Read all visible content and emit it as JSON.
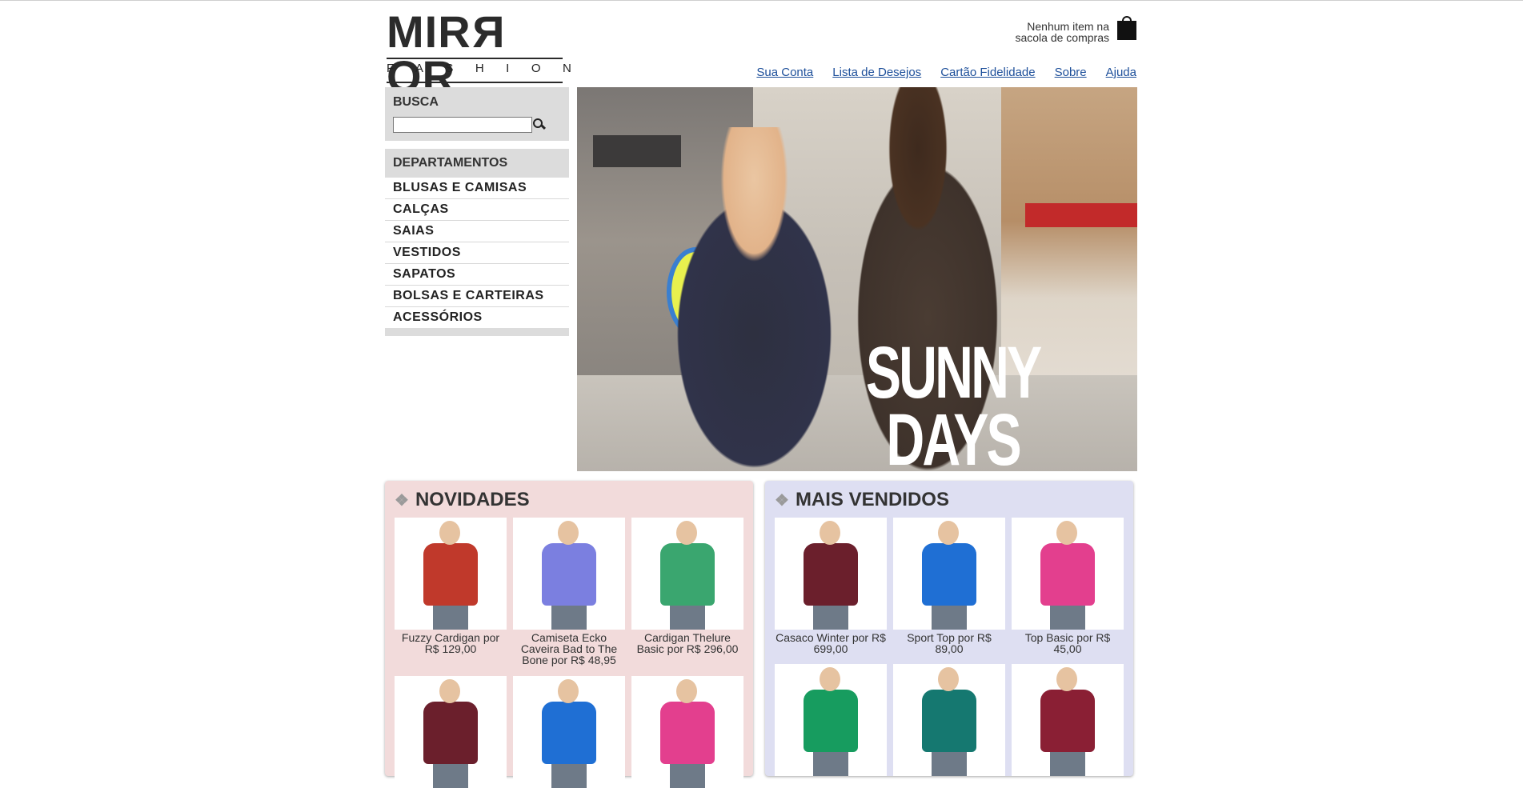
{
  "brand": {
    "logo_main": "MIRROR",
    "logo_sub": "FASHION"
  },
  "bag": {
    "text_line1": "Nenhum item na",
    "text_line2": "sacola de compras",
    "icon": "shopping-bag-icon"
  },
  "nav": {
    "links": [
      "Sua Conta",
      "Lista de Desejos",
      "Cartão Fidelidade",
      "Sobre",
      "Ajuda"
    ],
    "link_color": "#1d4f9a"
  },
  "search": {
    "title": "BUSCA",
    "value": "",
    "placeholder": "",
    "button_icon": "search-icon"
  },
  "departments": {
    "title": "DEPARTAMENTOS",
    "items": [
      "BLUSAS E CAMISAS",
      "CALÇAS",
      "SAIAS",
      "VESTIDOS",
      "SAPATOS",
      "BOLSAS E CARTEIRAS",
      "ACESSÓRIOS"
    ]
  },
  "banner": {
    "text_line1": "SUNNY",
    "text_line2": "DAYS"
  },
  "novidades": {
    "title": "NOVIDADES",
    "bg_color": "#f2dbdb",
    "products": [
      {
        "caption": "Fuzzy Cardigan por R$ 129,00",
        "color": "#c0392b"
      },
      {
        "caption": "Camiseta Ecko Caveira Bad to The Bone por R$ 48,95",
        "color": "#7b7fe0"
      },
      {
        "caption": "Cardigan Thelure Basic por R$ 296,00",
        "color": "#3aa66f"
      },
      {
        "caption": "",
        "color": "#6b1f2c"
      },
      {
        "caption": "",
        "color": "#1f6fd4"
      },
      {
        "caption": "",
        "color": "#e33f8e"
      }
    ]
  },
  "mais_vendidos": {
    "title": "MAIS VENDIDOS",
    "bg_color": "#dedff2",
    "products": [
      {
        "caption": "Casaco Winter por R$ 699,00",
        "color": "#6b1f2c"
      },
      {
        "caption": "Sport Top por R$ 89,00",
        "color": "#1f6fd4"
      },
      {
        "caption": "Top Basic por R$ 45,00",
        "color": "#e33f8e"
      },
      {
        "caption": "",
        "color": "#179c5f"
      },
      {
        "caption": "",
        "color": "#157870"
      },
      {
        "caption": "",
        "color": "#8a1f34"
      }
    ]
  }
}
